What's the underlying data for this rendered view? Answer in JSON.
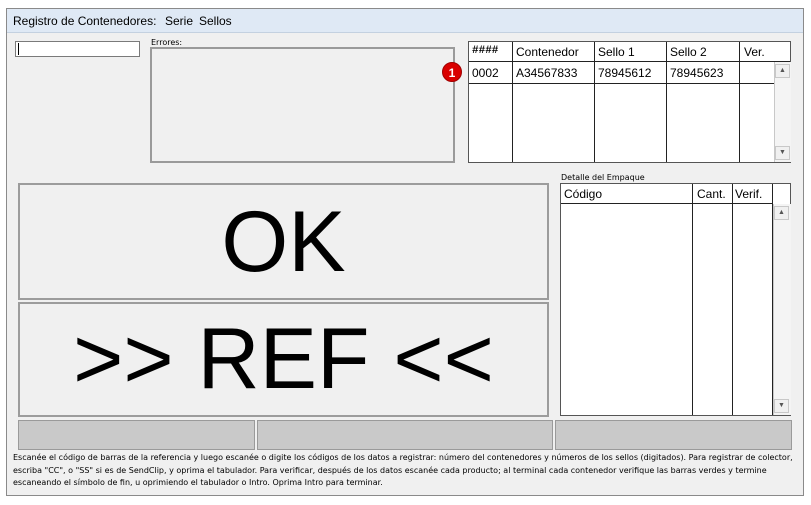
{
  "menu": {
    "title": "Registro de Contenedores:",
    "items": [
      "Serie",
      "Sellos"
    ]
  },
  "scan_input": {
    "value": ""
  },
  "errors": {
    "label": "Errores:",
    "text": ""
  },
  "containers_table": {
    "columns": [
      "####",
      "Contenedor",
      "Sello 1",
      "Sello 2",
      "Ver."
    ],
    "rows": [
      {
        "num": "0002",
        "container": "A34567833",
        "seal1": "78945612",
        "seal2": "78945623",
        "ver": ""
      }
    ],
    "badge": "1"
  },
  "detail": {
    "label": "Detalle del Empaque",
    "columns": [
      "Código",
      "Cant.",
      "Verif."
    ]
  },
  "status_main": "OK",
  "status_ref": ">> REF <<",
  "help_text": "Escanée el código de barras de la referencia y luego escanée o digite los códigos de los datos a registrar: número del contenedores y números de los sellos (digitados). Para registrar de colector, escriba \"CC\", o \"SS\" si es de SendClip, y oprima el tabulador. Para verificar, después de los datos escanée cada producto; al terminal cada contenedor verifique las barras verdes y termine escaneando el símbolo de fin, u oprimiendo el tabulador o Intro. Oprima Intro para terminar.",
  "colors": {
    "menubar": "#dfe9f5",
    "badge": "#d90000",
    "window": "#f0f0f0"
  }
}
